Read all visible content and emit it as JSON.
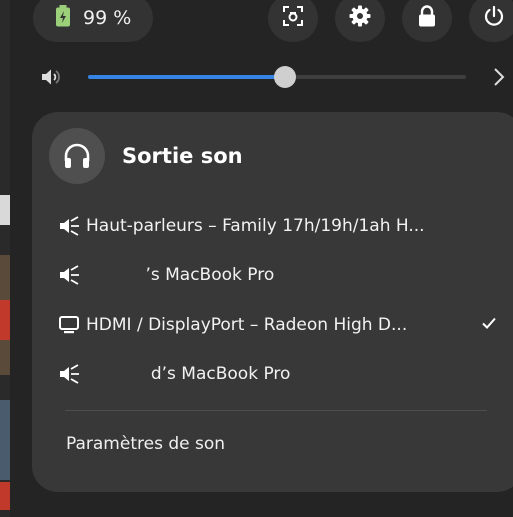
{
  "status": {
    "battery_percent": "99 %",
    "buttons": [
      {
        "name": "screenshot-icon"
      },
      {
        "name": "settings-icon"
      },
      {
        "name": "lock-icon"
      },
      {
        "name": "power-icon"
      }
    ]
  },
  "volume": {
    "level": 0.52,
    "accent": "#3584e4"
  },
  "sound_output": {
    "title": "Sortie son",
    "devices": [
      {
        "label": "Haut-parleurs – Family 17h/19h/1ah H...",
        "icon": "speaker-icon",
        "selected": false
      },
      {
        "label": "           ’s MacBook Pro",
        "icon": "speaker-icon",
        "selected": false
      },
      {
        "label": "HDMI / DisplayPort – Radeon High D...",
        "icon": "monitor-icon",
        "selected": true
      },
      {
        "label": "            d’s MacBook Pro",
        "icon": "speaker-icon",
        "selected": false
      }
    ],
    "settings_label": "Paramètres de son"
  }
}
